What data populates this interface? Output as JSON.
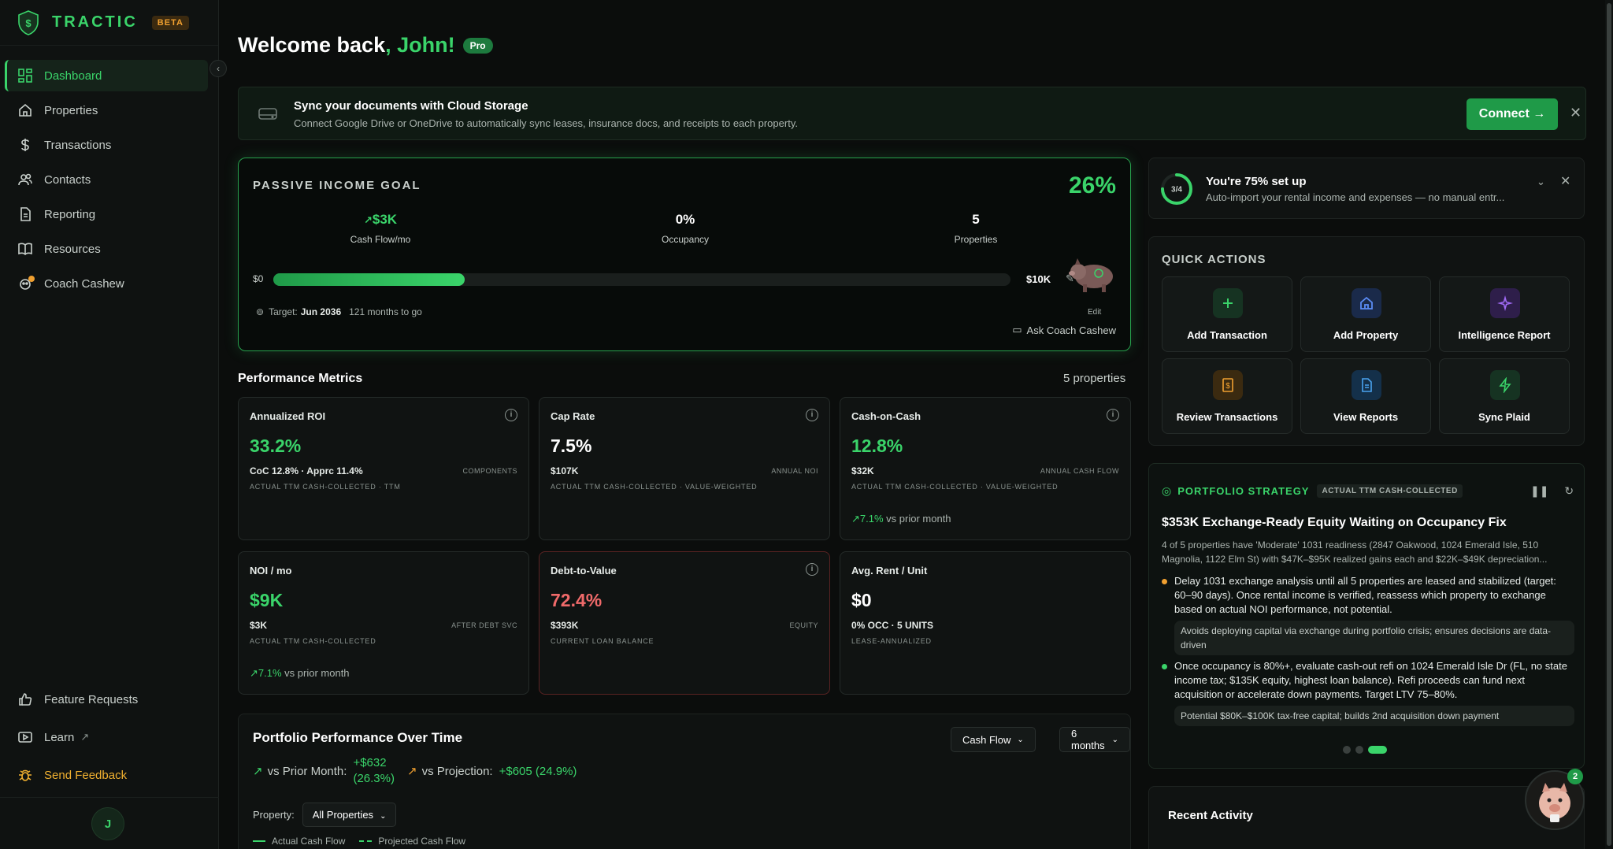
{
  "app": {
    "name": "TRACTIC",
    "beta": "BETA"
  },
  "sidebar": {
    "items": [
      {
        "label": "Dashboard"
      },
      {
        "label": "Properties"
      },
      {
        "label": "Transactions"
      },
      {
        "label": "Contacts"
      },
      {
        "label": "Reporting"
      },
      {
        "label": "Resources"
      },
      {
        "label": "Coach Cashew"
      }
    ],
    "bottom": [
      {
        "label": "Feature Requests"
      },
      {
        "label": "Learn"
      },
      {
        "label": "Send Feedback"
      }
    ],
    "avatar": "J"
  },
  "header": {
    "welcome": "Welcome back",
    "name": ", John!",
    "badge": "Pro"
  },
  "banner": {
    "title": "Sync your documents with Cloud Storage",
    "subtitle": "Connect Google Drive or OneDrive to automatically sync leases, insurance docs, and receipts to each property.",
    "button": "Connect →"
  },
  "goal": {
    "title": "PASSIVE INCOME GOAL",
    "percent": "26%",
    "progress": 0.26,
    "stats": [
      {
        "value": "$3K",
        "label": "Cash Flow/mo"
      },
      {
        "value": "0%",
        "label": "Occupancy"
      },
      {
        "value": "5",
        "label": "Properties"
      }
    ],
    "start": "$0",
    "end": "$10K",
    "edit": "Edit",
    "target_label": "Target:",
    "target_date": "Jun 2036",
    "months_to_go": "121 months to go",
    "ask_coach": "Ask Coach Cashew"
  },
  "performance": {
    "title": "Performance Metrics",
    "count": "5 properties",
    "metrics": [
      {
        "title": "Annualized ROI",
        "value": "33.2%",
        "sub": "CoC 12.8% · Apprc 11.4%",
        "sub_right": "COMPONENTS",
        "foot": "ACTUAL TTM CASH-COLLECTED · TTM",
        "trend": ""
      },
      {
        "title": "Cap Rate",
        "value": "7.5%",
        "sub": "$107K",
        "sub_right": "ANNUAL NOI",
        "foot": "ACTUAL TTM CASH-COLLECTED · VALUE-WEIGHTED",
        "trend": ""
      },
      {
        "title": "Cash-on-Cash",
        "value": "12.8%",
        "sub": "$32K",
        "sub_right": "ANNUAL CASH FLOW",
        "foot": "ACTUAL TTM CASH-COLLECTED · VALUE-WEIGHTED",
        "trend_value": "7.1%",
        "trend_text": "vs prior month"
      },
      {
        "title": "NOI / mo",
        "value": "$9K",
        "sub": "$3K",
        "sub_right": "AFTER DEBT SVC",
        "foot": "ACTUAL TTM CASH-COLLECTED",
        "trend_value": "7.1%",
        "trend_text": "vs prior month"
      },
      {
        "title": "Debt-to-Value",
        "value": "72.4%",
        "sub": "$393K",
        "sub_right": "EQUITY",
        "foot": "CURRENT LOAN BALANCE",
        "trend": ""
      },
      {
        "title": "Avg. Rent / Unit",
        "value": "$0",
        "sub": "0% OCC · 5 UNITS",
        "sub_right": "",
        "foot": "LEASE-ANNUALIZED",
        "trend": ""
      }
    ]
  },
  "portfolio_time": {
    "title": "Portfolio Performance Over Time",
    "metric_select": "Cash Flow",
    "range_select": "6 months",
    "vs_prior_label": "vs Prior Month:",
    "vs_prior_value": "+$632",
    "vs_prior_pct": "(26.3%)",
    "vs_proj_label": "vs Projection:",
    "vs_proj_value": "+$605 (24.9%)",
    "property_label": "Property:",
    "property_value": "All Properties",
    "legend_actual": "Actual Cash Flow",
    "legend_projected": "Projected Cash Flow"
  },
  "setup": {
    "ring": "3/4",
    "progress": 0.75,
    "title": "You're 75% set up",
    "subtitle": "Auto-import your rental income and expenses — no manual entr..."
  },
  "quick_actions": {
    "title": "QUICK ACTIONS",
    "items": [
      {
        "label": "Add Transaction",
        "icon": "plus-icon",
        "color": "#3ad46a"
      },
      {
        "label": "Add Property",
        "icon": "home-icon",
        "color": "#5b8cf5"
      },
      {
        "label": "Intelligence Report",
        "icon": "sparkle-icon",
        "color": "#a06af5"
      },
      {
        "label": "Review Transactions",
        "icon": "receipt-icon",
        "color": "#f0a030"
      },
      {
        "label": "View Reports",
        "icon": "document-icon",
        "color": "#4aa3f0"
      },
      {
        "label": "Sync Plaid",
        "icon": "lightning-icon",
        "color": "#3ad46a"
      }
    ]
  },
  "strategy": {
    "label": "PORTFOLIO STRATEGY",
    "badge": "ACTUAL TTM CASH-COLLECTED",
    "title": "$353K Exchange-Ready Equity Waiting on Occupancy Fix",
    "description": "4 of 5 properties have 'Moderate' 1031 readiness (2847 Oakwood, 1024 Emerald Isle, 510 Magnolia, 1122 Elm St) with $47K–$95K realized gains each and $22K–$49K depreciation...",
    "items": [
      {
        "text": "Delay 1031 exchange analysis until all 5 properties are leased and stabilized (target: 60–90 days). Once rental income is verified, reassess which property to exchange based on actual NOI performance, not potential.",
        "note": "Avoids deploying capital via exchange during portfolio crisis; ensures decisions are data-driven",
        "color": "#f0a030"
      },
      {
        "text": "Once occupancy is 80%+, evaluate cash-out refi on 1024 Emerald Isle Dr (FL, no state income tax; $135K equity, highest loan balance). Refi proceeds can fund next acquisition or accelerate down payments. Target LTV 75–80%.",
        "note": "Potential $80K–$100K tax-free capital; builds 2nd acquisition down payment",
        "color": "#3ad46a"
      }
    ]
  },
  "recent": {
    "title": "Recent Activity"
  },
  "coach_fab": {
    "badge": "2"
  }
}
